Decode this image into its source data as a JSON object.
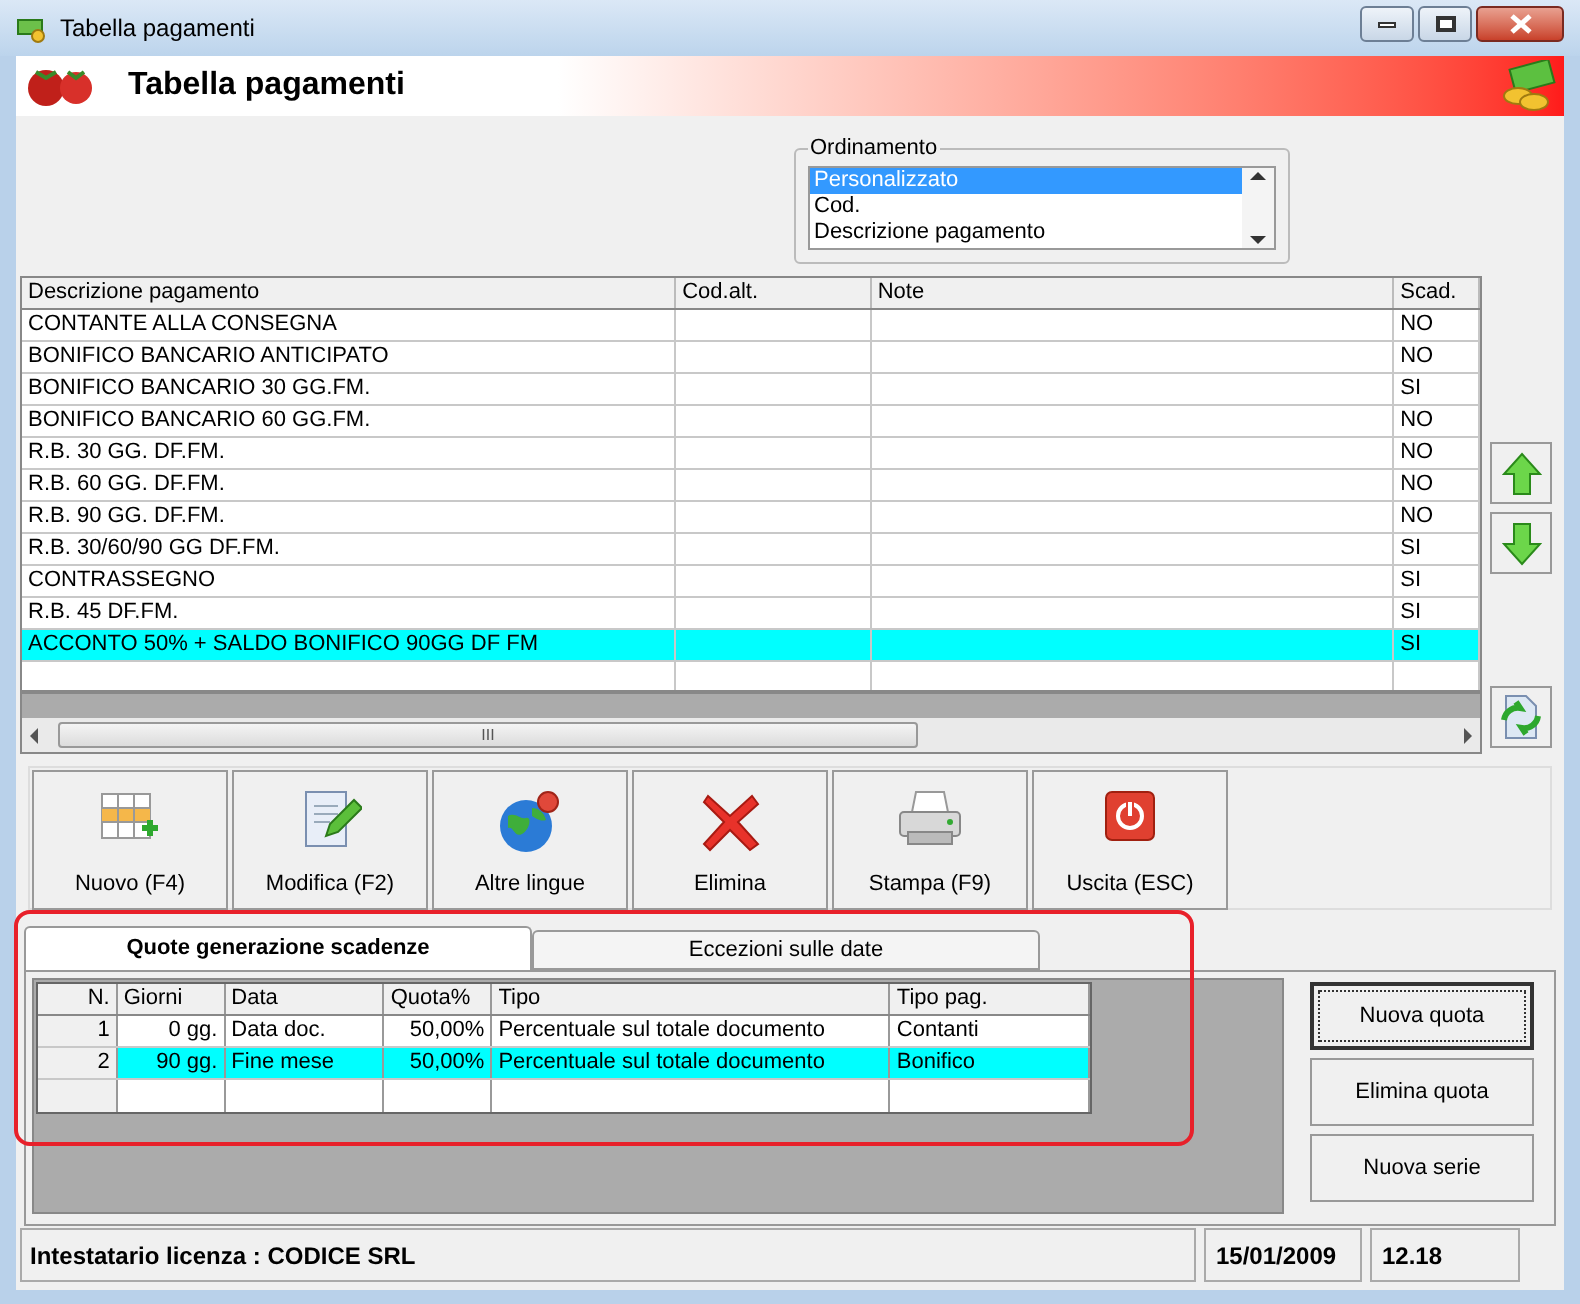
{
  "window": {
    "title": "Tabella pagamenti"
  },
  "banner": {
    "title": "Tabella pagamenti"
  },
  "sort_group": {
    "label": "Ordinamento",
    "options": [
      {
        "label": "Personalizzato",
        "selected": true
      },
      {
        "label": "Cod.",
        "selected": false
      },
      {
        "label": "Descrizione pagamento",
        "selected": false
      }
    ]
  },
  "table": {
    "columns": [
      "Descrizione pagamento",
      "Cod.alt.",
      "Note",
      "Scad."
    ],
    "rows": [
      {
        "cells": [
          "CONTANTE ALLA CONSEGNA",
          "",
          "",
          "NO"
        ],
        "selected": false
      },
      {
        "cells": [
          "BONIFICO BANCARIO ANTICIPATO",
          "",
          "",
          "NO"
        ],
        "selected": false
      },
      {
        "cells": [
          "BONIFICO BANCARIO 30 GG.FM.",
          "",
          "",
          "SI"
        ],
        "selected": false
      },
      {
        "cells": [
          "BONIFICO BANCARIO 60 GG.FM.",
          "",
          "",
          "NO"
        ],
        "selected": false
      },
      {
        "cells": [
          "R.B. 30 GG. DF.FM.",
          "",
          "",
          "NO"
        ],
        "selected": false
      },
      {
        "cells": [
          "R.B. 60 GG. DF.FM.",
          "",
          "",
          "NO"
        ],
        "selected": false
      },
      {
        "cells": [
          "R.B. 90 GG. DF.FM.",
          "",
          "",
          "NO"
        ],
        "selected": false
      },
      {
        "cells": [
          "R.B. 30/60/90 GG DF.FM.",
          "",
          "",
          "SI"
        ],
        "selected": false
      },
      {
        "cells": [
          "CONTRASSEGNO",
          "",
          "",
          "SI"
        ],
        "selected": false
      },
      {
        "cells": [
          "R.B. 45 DF.FM.",
          "",
          "",
          "SI"
        ],
        "selected": false
      },
      {
        "cells": [
          "ACCONTO 50% + SALDO BONIFICO 90GG DF FM",
          "",
          "",
          "SI"
        ],
        "selected": true
      }
    ],
    "scroll_grip": "III"
  },
  "toolbar": [
    {
      "label": "Nuovo (F4)",
      "kind": "new"
    },
    {
      "label": "Modifica (F2)",
      "kind": "edit"
    },
    {
      "label": "Altre lingue",
      "kind": "languages"
    },
    {
      "label": "Elimina",
      "kind": "delete"
    },
    {
      "label": "Stampa (F9)",
      "kind": "print"
    },
    {
      "label": "Uscita (ESC)",
      "kind": "exit"
    }
  ],
  "tabs": [
    {
      "label": "Quote generazione scadenze",
      "selected": true
    },
    {
      "label": "Eccezioni sulle date",
      "selected": false
    }
  ],
  "quota_table": {
    "columns": [
      "N.",
      "Giorni",
      "Data",
      "Quota%",
      "Tipo",
      "Tipo pag."
    ],
    "rows": [
      {
        "cells": [
          "1",
          "0 gg.",
          "Data doc.",
          "50,00%",
          "Percentuale sul totale documento",
          "Contanti"
        ],
        "selected": false
      },
      {
        "cells": [
          "2",
          "90 gg.",
          "Fine mese",
          "50,00%",
          "Percentuale sul totale documento",
          "Bonifico"
        ],
        "selected": true
      }
    ]
  },
  "side_buttons": [
    {
      "label": "Nuova quota",
      "focused": true
    },
    {
      "label": "Elimina quota",
      "focused": false
    },
    {
      "label": "Nuova serie",
      "focused": false
    }
  ],
  "status_bar": {
    "license": "Intestatario licenza : CODICE SRL",
    "date": "15/01/2009",
    "time": "12.18"
  }
}
